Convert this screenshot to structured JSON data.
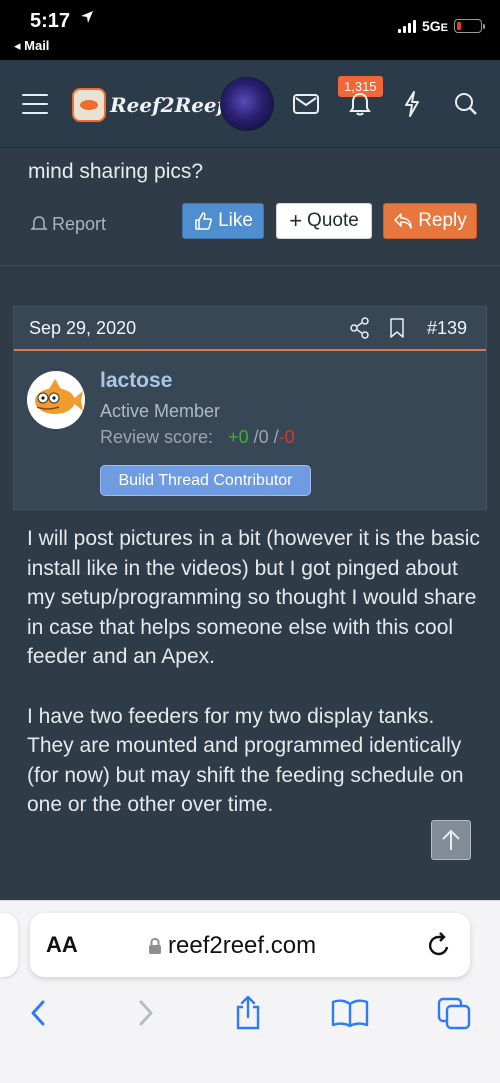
{
  "status_bar": {
    "time": "5:17",
    "back_label": "◂ Mail",
    "network": "5G",
    "network_suffix": "E"
  },
  "header": {
    "logo_text": "Reef2Reef",
    "alerts_count": "1,315"
  },
  "previous_post": {
    "text_tail": "mind sharing pics?",
    "report_label": "Report",
    "like_label": "Like",
    "quote_label": "Quote",
    "reply_label": "Reply"
  },
  "post": {
    "date": "Sep 29, 2020",
    "number": "#139",
    "username": "lactose",
    "user_title": "Active Member",
    "review_label": "Review score:",
    "review_positive": "+0",
    "review_neutral": "/0 /",
    "review_negative": "-0",
    "badge": "Build Thread Contributor",
    "paragraphs": [
      "I will post pictures in a bit (however it is the basic install like in the videos) but I got pinged about my setup/programming so thought I would share in case that helps someone else with this cool feeder and an Apex.",
      "I have two feeders for my two display tanks. They are mounted and programmed identically (for now) but may shift the feeding schedule on one or the other over time."
    ]
  },
  "browser": {
    "aa_label": "AA",
    "url": "reef2reef.com"
  },
  "colors": {
    "accent_orange": "#e8763f",
    "like_blue": "#4f8fcf",
    "safari_blue": "#2f7bf5"
  }
}
